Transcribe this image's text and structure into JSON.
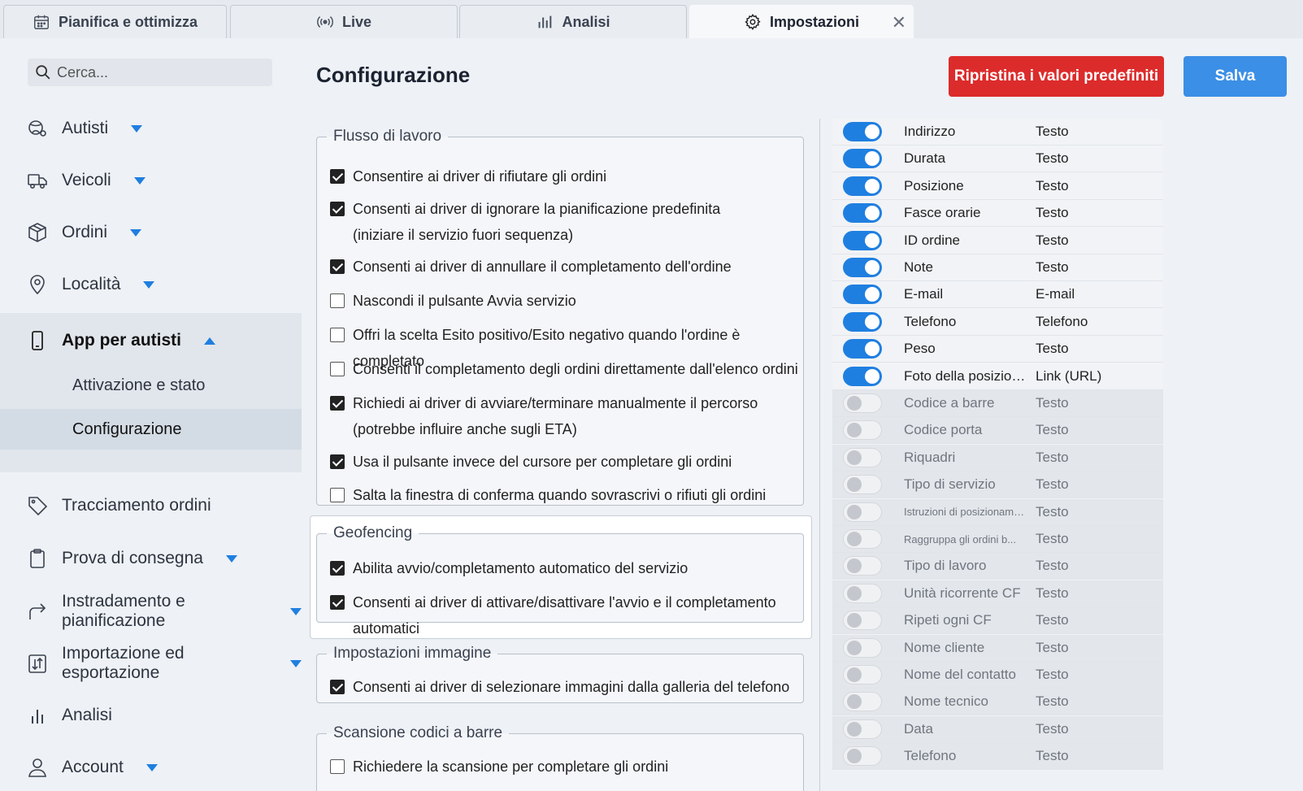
{
  "tabs": [
    {
      "label": "Pianifica e ottimizza",
      "icon": "calendar-icon"
    },
    {
      "label": "Live",
      "icon": "broadcast-icon"
    },
    {
      "label": "Analisi",
      "icon": "bar-chart-icon"
    },
    {
      "label": "Impostazioni",
      "icon": "gear-icon",
      "active": true
    }
  ],
  "search": {
    "placeholder": "Cerca..."
  },
  "sidebar": {
    "items": [
      {
        "label": "Autisti",
        "icon": "drivers-icon"
      },
      {
        "label": "Veicoli",
        "icon": "truck-icon"
      },
      {
        "label": "Ordini",
        "icon": "package-icon"
      },
      {
        "label": "Località",
        "icon": "location-pin-icon"
      },
      {
        "label": "App per autisti",
        "icon": "phone-icon",
        "expanded": true
      },
      {
        "label": "Tracciamento ordini",
        "icon": "tag-icon"
      },
      {
        "label": "Prova di consegna",
        "icon": "clipboard-icon"
      },
      {
        "label": "Instradamento e pianificazione",
        "icon": "route-arrow-icon"
      },
      {
        "label": "Importazione ed esportazione",
        "icon": "import-export-icon"
      },
      {
        "label": "Analisi",
        "icon": "analytics-icon"
      },
      {
        "label": "Account",
        "icon": "user-icon"
      }
    ],
    "subitems": [
      {
        "label": "Attivazione e stato"
      },
      {
        "label": "Configurazione",
        "active": true
      }
    ]
  },
  "header": {
    "title": "Configurazione",
    "reset_label": "Ripristina i valori predefiniti",
    "save_label": "Salva"
  },
  "colors": {
    "accent": "#1f7fe0",
    "danger": "#dc2b2b",
    "save": "#3b8fe6"
  },
  "workflow": {
    "legend": "Flusso di lavoro",
    "options": [
      {
        "label": "Consentire ai driver di rifiutare gli ordini",
        "checked": true
      },
      {
        "label": "Consenti ai driver di ignorare la pianificazione predefinita (iniziare il servizio fuori sequenza)",
        "checked": true
      },
      {
        "label": "Consenti ai driver di annullare il completamento dell'ordine",
        "checked": true
      },
      {
        "label": "Nascondi il pulsante Avvia servizio",
        "checked": false
      },
      {
        "label": "Offri la scelta Esito positivo/Esito negativo quando l'ordine è completato",
        "checked": false
      },
      {
        "label": "Consenti il completamento degli ordini direttamente dall'elenco ordini",
        "checked": false
      },
      {
        "label": "Richiedi ai driver di avviare/terminare manualmente il percorso (potrebbe influire anche sugli ETA)",
        "checked": true
      },
      {
        "label": "Usa il pulsante invece del cursore per completare gli ordini",
        "checked": true
      },
      {
        "label": "Salta la finestra di conferma quando sovrascrivi o rifiuti gli ordini",
        "checked": false
      }
    ]
  },
  "geofencing": {
    "legend": "Geofencing",
    "options": [
      {
        "label": "Abilita avvio/completamento automatico del servizio",
        "checked": true
      },
      {
        "label": "Consenti ai driver di attivare/disattivare l'avvio e il completamento automatici",
        "checked": true
      }
    ]
  },
  "image_settings": {
    "legend": "Impostazioni immagine",
    "options": [
      {
        "label": "Consenti ai driver di selezionare immagini dalla galleria del telefono",
        "checked": true
      }
    ]
  },
  "barcode": {
    "legend": "Scansione codici a barre",
    "options": [
      {
        "label": "Richiedere la scansione per completare gli ordini",
        "checked": false
      }
    ]
  },
  "fields": [
    {
      "name": "Indirizzo",
      "type": "Testo",
      "enabled": true
    },
    {
      "name": "Durata",
      "type": "Testo",
      "enabled": true
    },
    {
      "name": "Posizione",
      "type": "Testo",
      "enabled": true
    },
    {
      "name": "Fasce orarie",
      "type": "Testo",
      "enabled": true
    },
    {
      "name": "ID ordine",
      "type": "Testo",
      "enabled": true
    },
    {
      "name": "Note",
      "type": "Testo",
      "enabled": true
    },
    {
      "name": "E-mail",
      "type": "E-mail",
      "enabled": true
    },
    {
      "name": "Telefono",
      "type": "Telefono",
      "enabled": true
    },
    {
      "name": "Peso",
      "type": "Testo",
      "enabled": true
    },
    {
      "name": "Foto della posizione",
      "type": "Link (URL)",
      "enabled": true
    },
    {
      "name": "Codice a barre",
      "type": "Testo",
      "enabled": false
    },
    {
      "name": "Codice porta",
      "type": "Testo",
      "enabled": false
    },
    {
      "name": "Riquadri",
      "type": "Testo",
      "enabled": false
    },
    {
      "name": "Tipo di servizio",
      "type": "Testo",
      "enabled": false
    },
    {
      "name": "Istruzioni di posizionamento",
      "type": "Testo",
      "enabled": false
    },
    {
      "name": "Raggruppa gli ordini b...",
      "type": "Testo",
      "enabled": false
    },
    {
      "name": "Tipo di lavoro",
      "type": "Testo",
      "enabled": false
    },
    {
      "name": "Unità ricorrente CF",
      "type": "Testo",
      "enabled": false
    },
    {
      "name": "Ripeti ogni CF",
      "type": "Testo",
      "enabled": false
    },
    {
      "name": "Nome cliente",
      "type": "Testo",
      "enabled": false
    },
    {
      "name": "Nome del contatto",
      "type": "Testo",
      "enabled": false
    },
    {
      "name": "Nome tecnico",
      "type": "Testo",
      "enabled": false
    },
    {
      "name": "Data",
      "type": "Testo",
      "enabled": false
    },
    {
      "name": "Telefono",
      "type": "Testo",
      "enabled": false
    }
  ]
}
